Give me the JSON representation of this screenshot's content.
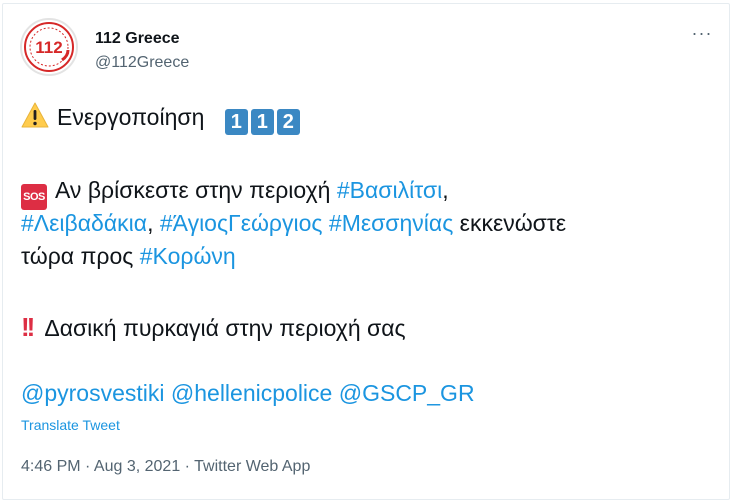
{
  "header": {
    "name": "112 Greece",
    "handle": "@112Greece",
    "avatar_text": "112",
    "more": "···"
  },
  "body": {
    "line1": {
      "text": "Ενεργοποίηση",
      "keycaps": [
        "1",
        "1",
        "2"
      ]
    },
    "line2": {
      "sos_badge": "SOS",
      "text": "Αν βρίσκεστε στην περιοχή ",
      "tag1": "#Βασιλίτσι",
      "comma": ","
    },
    "line3": {
      "tag2": "#Λειβαδάκια",
      "sep": ", ",
      "tag3": "#ΆγιοςΓεώργιος",
      "space": " ",
      "tag4": "#Μεσσηνίας",
      "text": " εκκενώστε"
    },
    "line4": {
      "text": "τώρα προς ",
      "tag5": "#Κορώνη"
    },
    "line5": {
      "text": "Δασική πυρκαγιά στην περιοχή σας"
    },
    "mentions": [
      "@pyrosvestiki",
      "@hellenicpolice",
      "@GSCP_GR"
    ]
  },
  "translate_label": "Translate Tweet",
  "meta": "4:46 PM · Aug 3, 2021 · Twitter Web App",
  "colors": {
    "link": "#1b95e0",
    "keycap": "#3b88c3",
    "sos": "#dd2e44",
    "secondary_text": "#536471"
  },
  "icons": [
    "warning-icon",
    "keycap-icon",
    "sos-icon",
    "double-exclamation-icon",
    "more-icon"
  ]
}
